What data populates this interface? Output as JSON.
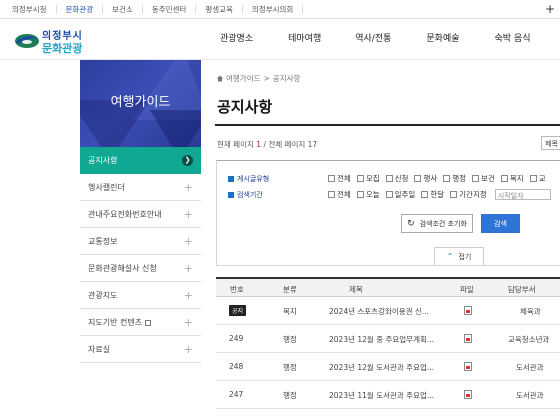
{
  "topbar": {
    "links": [
      "의정부시청",
      "문화관광",
      "보건소",
      "동주민센터",
      "평생교육",
      "의정부시의회"
    ],
    "active_index": 1,
    "plus_label": "+"
  },
  "header": {
    "logo_line1": "의정부시",
    "logo_line2": "문화관광",
    "nav": [
      "관광명소",
      "테마여행",
      "역사/전통",
      "문화예술",
      "숙박 음식"
    ]
  },
  "sidebar": {
    "title": "여행가이드",
    "items": [
      {
        "label": "공지사항",
        "active": true
      },
      {
        "label": "행사캘린더"
      },
      {
        "label": "관내주요전화번호안내"
      },
      {
        "label": "교통정보"
      },
      {
        "label": "문화관광해설사 신청"
      },
      {
        "label": "관광지도"
      },
      {
        "label": "지도기반 컨텐츠"
      },
      {
        "label": "자료실"
      }
    ]
  },
  "breadcrumb": {
    "items": [
      "여행가이드",
      "공지사항"
    ],
    "separator": ">"
  },
  "page_title": "공지사항",
  "pageinfo": {
    "current_label": "현재 페이지",
    "current": "1",
    "total_label": "/ 전체 페이지",
    "total": "17"
  },
  "sort_select": {
    "value": "제목"
  },
  "filters": {
    "type_label": "게시글유형",
    "type_options": [
      "전체",
      "모집",
      "신청",
      "행사",
      "행정",
      "보건",
      "복지",
      "교"
    ],
    "period_label": "검색기간",
    "period_options": [
      "전체",
      "오늘",
      "일주일",
      "한달",
      "기간지정"
    ],
    "start_placeholder": "시작일자",
    "reset_label": "검색조건 초기화",
    "search_label": "검색",
    "fold_label": "접기"
  },
  "table": {
    "headers": [
      "번호",
      "분류",
      "제목",
      "파일",
      "담당부서"
    ],
    "rows": [
      {
        "no": "공지",
        "category": "복지",
        "title": "2024년 스포츠강좌이용권 신...",
        "file": "pdf-icon",
        "dept": "체육과"
      },
      {
        "no": "249",
        "category": "행정",
        "title": "2023년 12월 중 주요업무계획...",
        "file": "hwp-icon",
        "dept": "교육청소년과"
      },
      {
        "no": "248",
        "category": "행정",
        "title": "2023년 12월 도서관과 주요업...",
        "file": "hwp-icon",
        "dept": "도서관과"
      },
      {
        "no": "247",
        "category": "행정",
        "title": "2023년 11월 도서관과 주요업...",
        "file": "hwp-icon",
        "dept": "도서관과"
      }
    ]
  },
  "colors": {
    "accent_green": "#11a893",
    "nav_blue": "#2c3d9c",
    "search_button": "#2d74d6"
  }
}
